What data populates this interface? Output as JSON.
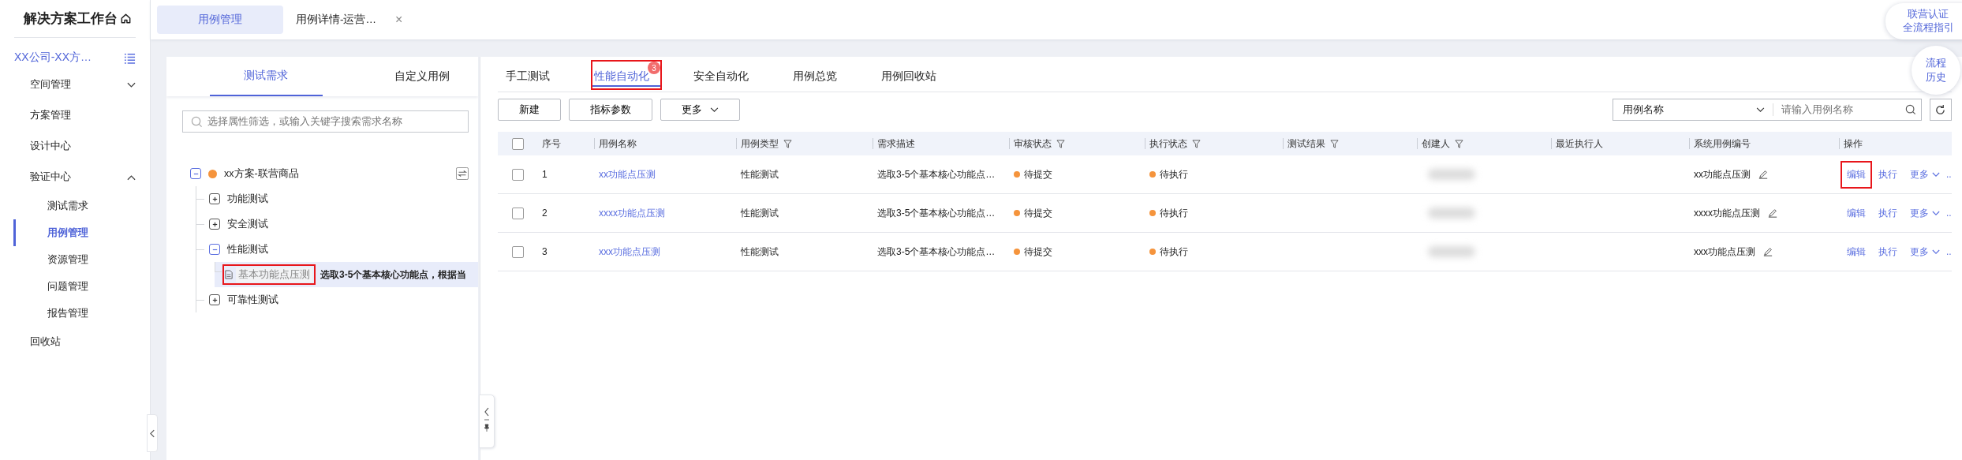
{
  "sidebar": {
    "title": "解决方案工作台",
    "project": "XX公司-XX方…",
    "items": [
      {
        "label": "空间管理",
        "expanded": false,
        "selected": false
      },
      {
        "label": "方案管理",
        "selected": false
      },
      {
        "label": "设计中心",
        "selected": false
      },
      {
        "label": "验证中心",
        "expanded": true,
        "selected": false,
        "children": [
          {
            "label": "测试需求",
            "selected": false
          },
          {
            "label": "用例管理",
            "selected": true
          },
          {
            "label": "资源管理",
            "selected": false
          },
          {
            "label": "问题管理",
            "selected": false
          },
          {
            "label": "报告管理",
            "selected": false
          }
        ]
      },
      {
        "label": "回收站",
        "selected": false
      }
    ]
  },
  "top_tabs": [
    {
      "label": "用例管理",
      "selected": true,
      "closable": false
    },
    {
      "label": "用例详情-运营…",
      "selected": false,
      "closable": true
    }
  ],
  "close_mark": "×",
  "guide_button": [
    "联营认证",
    "全流程指引"
  ],
  "history_button": [
    "流程",
    "历史"
  ],
  "tree_panel": {
    "tabs": [
      {
        "label": "测试需求",
        "selected": true
      },
      {
        "label": "自定义用例",
        "selected": false
      }
    ],
    "search": {
      "placeholder": "选择属性筛选，或输入关键字搜索需求名称"
    },
    "tree": [
      {
        "label": "xx方案-联营商品",
        "color": "#f5943c",
        "expanded": true,
        "children": [
          {
            "label": "功能测试",
            "expanded": false
          },
          {
            "label": "安全测试",
            "expanded": false
          },
          {
            "label": "性能测试",
            "expanded": true,
            "children": [
              {
                "label": "基本功能点压测",
                "description": "选取3-5个基本核心功能点，根据当",
                "selected": true,
                "highlighted": true
              }
            ]
          },
          {
            "label": "可靠性测试",
            "expanded": false
          }
        ]
      }
    ]
  },
  "case_tabs": [
    {
      "label": "手工测试",
      "selected": false,
      "highlighted": false
    },
    {
      "label": "性能自动化",
      "selected": true,
      "badge": "3",
      "highlighted": true
    },
    {
      "label": "安全自动化",
      "selected": false,
      "highlighted": false
    },
    {
      "label": "用例总览",
      "selected": false,
      "highlighted": false
    },
    {
      "label": "用例回收站",
      "selected": false,
      "highlighted": false
    }
  ],
  "toolbar": [
    {
      "label": "新建",
      "dropdown": false
    },
    {
      "label": "指标参数",
      "dropdown": false
    },
    {
      "label": "更多",
      "dropdown": true
    }
  ],
  "search": {
    "field": "用例名称",
    "placeholder": "请输入用例名称"
  },
  "table": {
    "header_checked": false,
    "columns": [
      {
        "label": "序号",
        "filter": false
      },
      {
        "label": "用例名称",
        "filter": false
      },
      {
        "label": "用例类型",
        "filter": true
      },
      {
        "label": "需求描述",
        "filter": false
      },
      {
        "label": "审核状态",
        "filter": true
      },
      {
        "label": "执行状态",
        "filter": true
      },
      {
        "label": "测试结果",
        "filter": true
      },
      {
        "label": "创建人",
        "filter": true
      },
      {
        "label": "最近执行人",
        "filter": false
      },
      {
        "label": "系统用例编号",
        "filter": false
      },
      {
        "label": "操作",
        "filter": false
      }
    ],
    "rows": [
      {
        "checked": false,
        "no": "1",
        "name": "xx功能点压测",
        "type": "性能测试",
        "description": "选取3-5个基本核心功能点…",
        "review": {
          "text": "待提交",
          "color": "#f5943c"
        },
        "exec": {
          "text": "待执行",
          "color": "#f5943c"
        },
        "system_id": "xx功能点压测",
        "actions": [
          {
            "label": "编辑",
            "dropdown": false,
            "highlighted": true
          },
          {
            "label": "执行",
            "dropdown": false,
            "highlighted": false
          },
          {
            "label": "更多",
            "dropdown": true,
            "highlighted": false
          }
        ],
        "overflow": ".."
      },
      {
        "checked": false,
        "no": "2",
        "name": "xxxx功能点压测",
        "type": "性能测试",
        "description": "选取3-5个基本核心功能点…",
        "review": {
          "text": "待提交",
          "color": "#f5943c"
        },
        "exec": {
          "text": "待执行",
          "color": "#f5943c"
        },
        "system_id": "xxxx功能点压测",
        "actions": [
          {
            "label": "编辑",
            "dropdown": false,
            "highlighted": false
          },
          {
            "label": "执行",
            "dropdown": false,
            "highlighted": false
          },
          {
            "label": "更多",
            "dropdown": true,
            "highlighted": false
          }
        ],
        "overflow": ".."
      },
      {
        "checked": false,
        "no": "3",
        "name": "xxx功能点压测",
        "type": "性能测试",
        "description": "选取3-5个基本核心功能点…",
        "review": {
          "text": "待提交",
          "color": "#f5943c"
        },
        "exec": {
          "text": "待执行",
          "color": "#f5943c"
        },
        "system_id": "xxx功能点压测",
        "actions": [
          {
            "label": "编辑",
            "dropdown": false,
            "highlighted": false
          },
          {
            "label": "执行",
            "dropdown": false,
            "highlighted": false
          },
          {
            "label": "更多",
            "dropdown": true,
            "highlighted": false
          }
        ],
        "overflow": ".."
      }
    ]
  }
}
